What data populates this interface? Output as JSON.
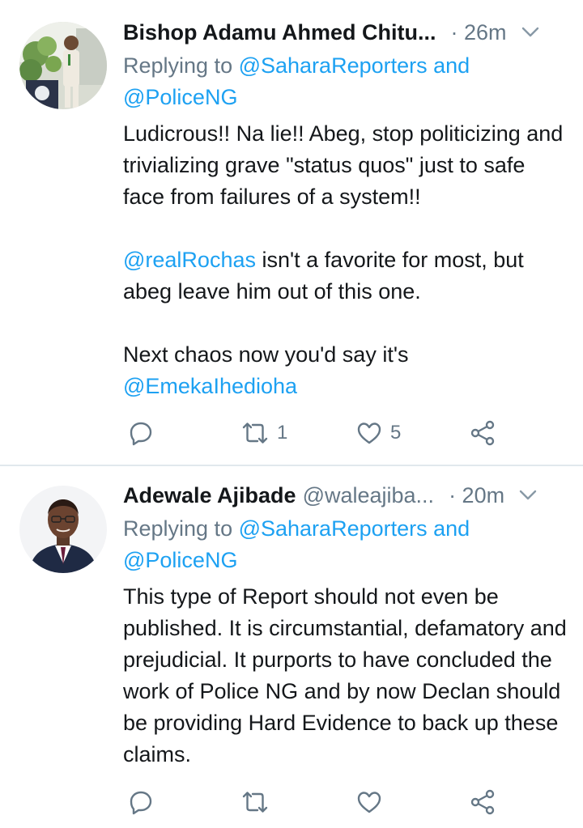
{
  "colors": {
    "link": "#1da1f2",
    "secondary_text": "#657786",
    "primary_text": "#14171a",
    "divider": "#e1e8ed"
  },
  "tweets": [
    {
      "display_name": "Bishop Adamu Ahmed Chitu...",
      "handle": "",
      "time": "· 26m",
      "replying_prefix": "Replying to ",
      "replying_mention_1": "@SaharaReporters",
      "replying_and": " and",
      "replying_mention_2": "@PoliceNG",
      "body": {
        "line_1": "Ludicrous!! Na lie!! Abeg, stop politicizing and trivializing grave \"status quos\" just to safe face from failures of a system!!",
        "mention_a": "@realRochas",
        "line_2": " isn't a favorite for most, but abeg leave him out of this one.",
        "line_3": "Next chaos now you'd say it's ",
        "mention_b": "@EmekaIhedioha"
      },
      "retweet_count": "1",
      "like_count": "5",
      "icons": [
        "reply-icon",
        "retweet-icon",
        "like-icon",
        "share-icon",
        "chevron-down-icon"
      ]
    },
    {
      "display_name": "Adewale Ajibade",
      "handle": "@waleajiba...",
      "time": "· 20m",
      "replying_prefix": "Replying to ",
      "replying_mention_1": "@SaharaReporters",
      "replying_and": " and",
      "replying_mention_2": "@PoliceNG",
      "body": {
        "line_1": "This type of Report should not even be published. It is circumstantial, defamatory and prejudicial. It purports to have concluded the work of Police NG and by now Declan should be providing Hard Evidence to back up these claims."
      },
      "retweet_count": "",
      "like_count": "",
      "icons": [
        "reply-icon",
        "retweet-icon",
        "like-icon",
        "share-icon",
        "chevron-down-icon"
      ]
    }
  ]
}
